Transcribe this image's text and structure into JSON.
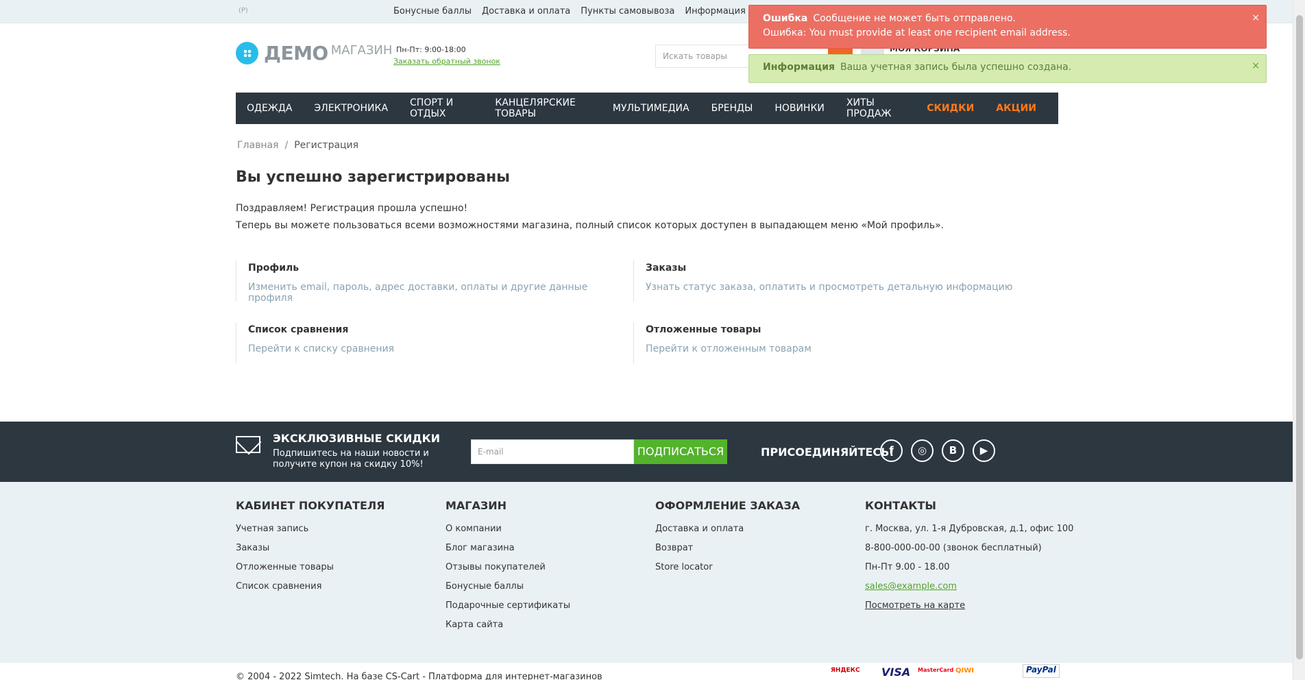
{
  "topbar": {
    "lang": "(Р)",
    "links": [
      "Бонусные баллы",
      "Доставка и оплата",
      "Пункты самовывоза",
      "Информация"
    ]
  },
  "header": {
    "logo_main": "ДЕМО",
    "logo_sub": "МАГАЗИН",
    "hours": "Пн-Пт: 9:00-18:00",
    "callback": "Заказать обратный звонок",
    "search_placeholder": "Искать товары",
    "cart_label": "МОЯ КОРЗИНА"
  },
  "menu": {
    "items": [
      "ОДЕЖДА",
      "ЭЛЕКТРОНИКА",
      "СПОРТ И ОТДЫХ",
      "КАНЦЕЛЯРСКИЕ ТОВАРЫ",
      "МУЛЬТИМЕДИА",
      "БРЕНДЫ",
      "НОВИНКИ",
      "ХИТЫ ПРОДАЖ"
    ],
    "accent_items": [
      "СКИДКИ",
      "АКЦИИ"
    ],
    "accent_color": "#ff7a1a"
  },
  "breadcrumbs": {
    "home": "Главная",
    "sep": "/",
    "current": "Регистрация"
  },
  "main": {
    "title": "Вы успешно зарегистрированы",
    "line1": "Поздравляем! Регистрация прошла успешно!",
    "line2": "Теперь вы можете пользоваться всеми возможностями магазина, полный список которых доступен в выпадающем меню «Мой профиль».",
    "cards": [
      {
        "title": "Профиль",
        "desc": "Изменить email, пароль, адрес доставки, оплаты и другие данные профиля"
      },
      {
        "title": "Заказы",
        "desc": "Узнать статус заказа, оплатить и просмотреть детальную информацию"
      },
      {
        "title": "Список сравнения",
        "desc": "Перейти к списку сравнения"
      },
      {
        "title": "Отложенные товары",
        "desc": "Перейти к отложенным товарам"
      }
    ]
  },
  "subscribe": {
    "title": "ЭКСКЛЮЗИВНЫЕ СКИДКИ",
    "text": "Подпишитесь на наши новости и получите купон на скидку 10%!",
    "email_placeholder": "E-mail",
    "button": "ПОДПИСАТЬСЯ",
    "join": "ПРИСОЕДИНЯЙТЕСЬ!",
    "social": [
      "f",
      "◎",
      "В",
      "▶"
    ]
  },
  "footer": {
    "col1": {
      "title": "КАБИНЕТ ПОКУПАТЕЛЯ",
      "links": [
        "Учетная запись",
        "Заказы",
        "Отложенные товары",
        "Список сравнения"
      ]
    },
    "col2": {
      "title": "МАГАЗИН",
      "links": [
        "О компании",
        "Блог магазина",
        "Отзывы покупателей",
        "Бонусные баллы",
        "Подарочные сертификаты",
        "Карта сайта"
      ]
    },
    "col3": {
      "title": "ОФОРМЛЕНИЕ ЗАКАЗА",
      "links": [
        "Доставка и оплата",
        "Возврат",
        "Store locator"
      ]
    },
    "col4": {
      "title": "КОНТАКТЫ",
      "address": "г. Москва, ул. 1-я Дубровская, д.1, офис 100",
      "phone": "8-800-000-00-00 (звонок бесплатный)",
      "hours": "Пн-Пт 9.00 - 18.00",
      "email": "sales@example.com",
      "map": "Посмотреть на карте"
    }
  },
  "bottom": {
    "copyright": "© 2004 - 2022 Simtech.  На базе CS-Cart - Платформа для интернет-магазинов",
    "payments": [
      "ЯНДЕКС",
      "VISA",
      "MasterCard",
      "QIWI",
      "PayPal"
    ]
  },
  "notifications": {
    "error": {
      "title": "Ошибка",
      "line1": "Сообщение не может быть отправлено.",
      "line2": "Ошибка: You must provide at least one recipient email address.",
      "close": "×"
    },
    "info": {
      "title": "Информация",
      "text": "Ваша учетная запись была успешно создана.",
      "close": "×"
    }
  }
}
